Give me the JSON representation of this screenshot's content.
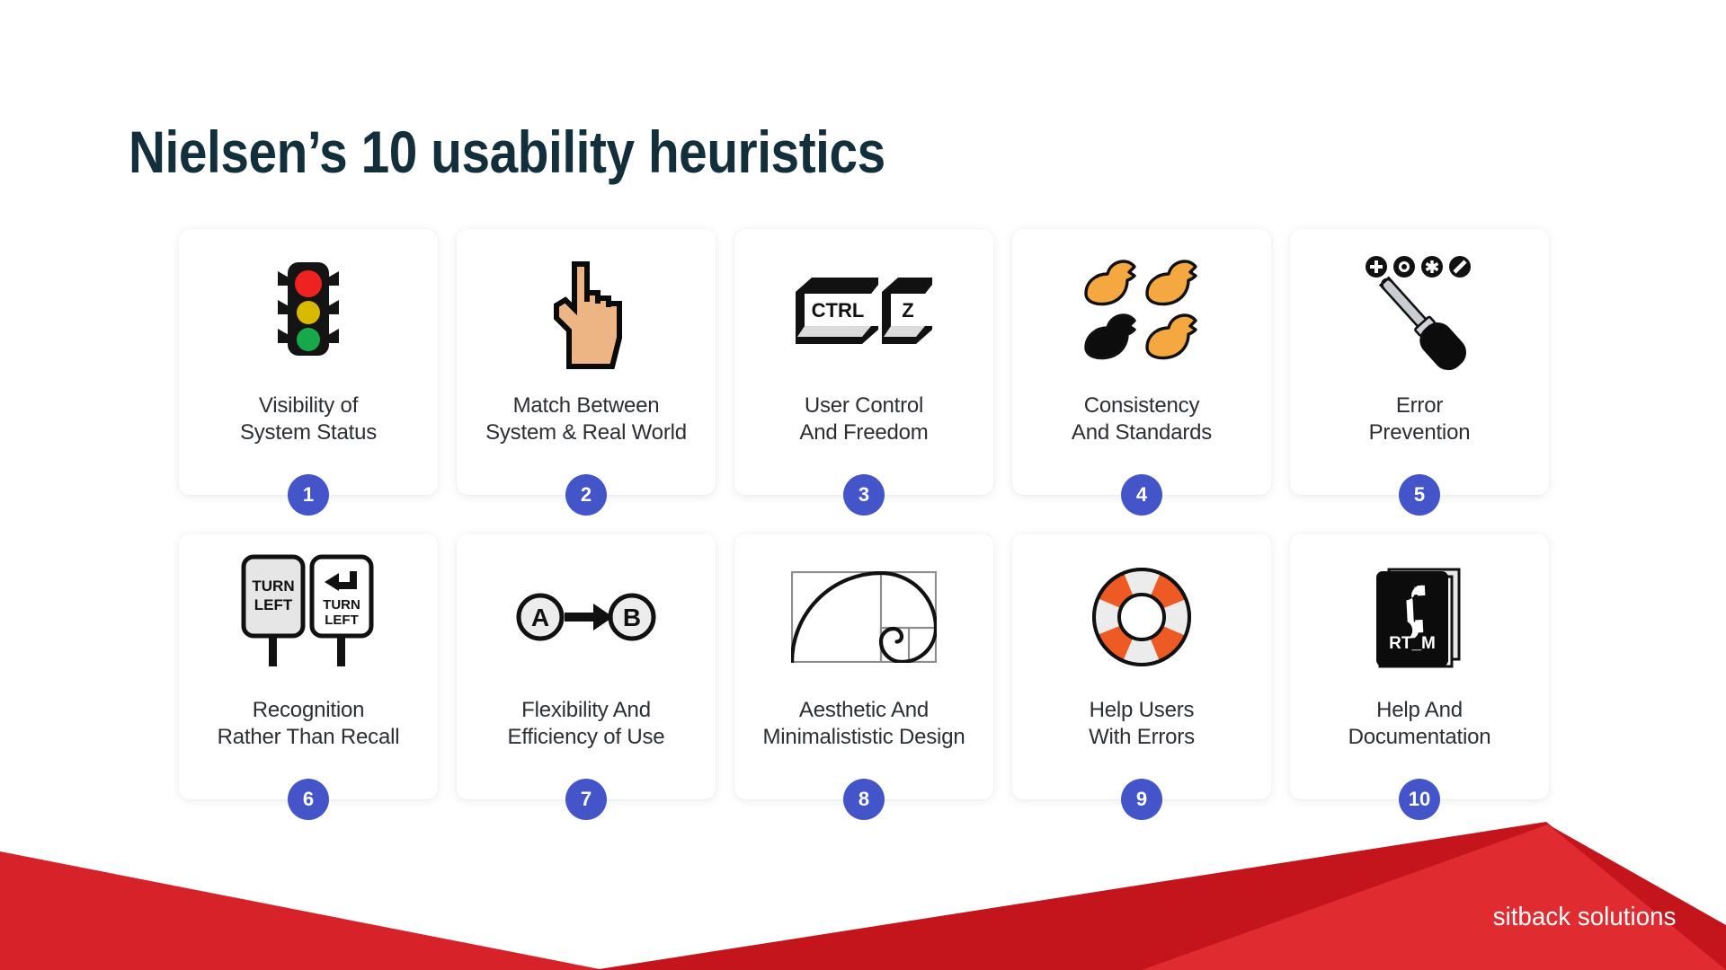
{
  "slide": {
    "title": "Nielsen’s 10 usability heuristics",
    "background_color": "#ffffff",
    "title_color": "#132f3c",
    "badge_color": "#4355c9",
    "footer_red": "#d8222a",
    "footer_red_dark": "#c4151c",
    "footer_red_light": "#e02b30"
  },
  "cards": [
    {
      "number": "1",
      "line1": "Visibility of",
      "line2": "System Status",
      "icon": "traffic-light-icon"
    },
    {
      "number": "2",
      "line1": "Match Between",
      "line2": "System & Real World",
      "icon": "pointing-hand-cursor-icon"
    },
    {
      "number": "3",
      "line1": "User Control",
      "line2": "And Freedom",
      "icon": "ctrl-z-keys-icon",
      "key1": "CTRL",
      "key2": "Z"
    },
    {
      "number": "4",
      "line1": "Consistency",
      "line2": "And Standards",
      "icon": "rubber-ducks-icon"
    },
    {
      "number": "5",
      "line1": "Error",
      "line2": "Prevention",
      "icon": "screwdriver-icon"
    },
    {
      "number": "6",
      "line1": "Recognition",
      "line2": "Rather Than Recall",
      "icon": "turn-left-signs-icon",
      "sign_text_a": "TURN LEFT",
      "sign_text_b": "TURN LEFT"
    },
    {
      "number": "7",
      "line1": "Flexibility And",
      "line2": "Efficiency of Use",
      "icon": "a-to-b-arrow-icon",
      "node_a": "A",
      "node_b": "B"
    },
    {
      "number": "8",
      "line1": "Aesthetic And",
      "line2": "Minimalististic Design",
      "icon": "golden-ratio-spiral-icon"
    },
    {
      "number": "9",
      "line1": "Help Users",
      "line2": "With Errors",
      "icon": "life-ring-icon"
    },
    {
      "number": "10",
      "line1": "Help And",
      "line2": "Documentation",
      "icon": "manual-book-icon",
      "book_text": "RT_M"
    }
  ],
  "footer": {
    "brand": "sitback solutions"
  }
}
